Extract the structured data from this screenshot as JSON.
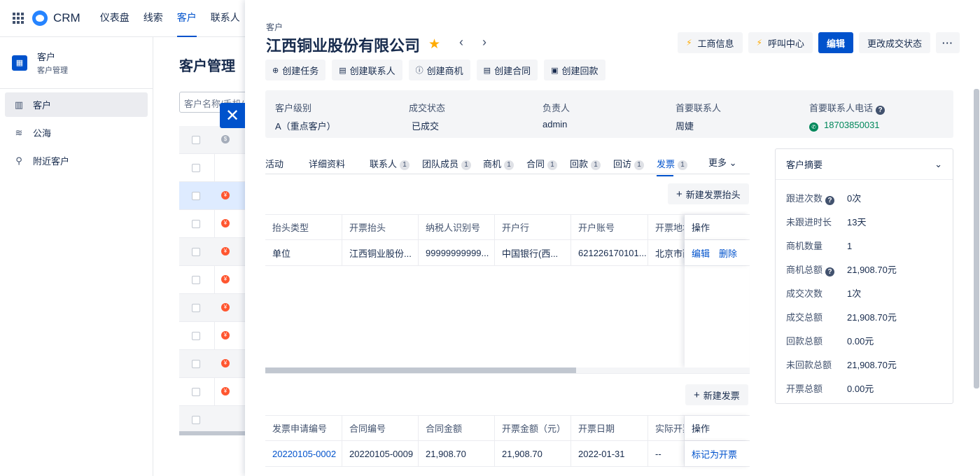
{
  "topnav": {
    "brand": "CRM",
    "items": [
      {
        "label": "仪表盘"
      },
      {
        "label": "线索"
      },
      {
        "label": "客户",
        "active": true
      },
      {
        "label": "联系人"
      }
    ]
  },
  "sidebar": {
    "title": "客户",
    "subtitle": "客户管理",
    "items": [
      {
        "label": "客户",
        "active": true
      },
      {
        "label": "公海"
      },
      {
        "label": "附近客户"
      }
    ]
  },
  "background": {
    "page_title": "客户管理",
    "search_placeholder": "客户名称/手机/"
  },
  "drawer": {
    "breadcrumb": "客户",
    "title": "江西铜业股份有限公司",
    "actions": {
      "business_info": "工商信息",
      "call_center": "呼叫中心",
      "edit": "编辑",
      "change_status": "更改成交状态",
      "more": "···"
    },
    "create_buttons": [
      {
        "label": "创建任务"
      },
      {
        "label": "创建联系人"
      },
      {
        "label": "创建商机"
      },
      {
        "label": "创建合同"
      },
      {
        "label": "创建回款"
      }
    ],
    "info": {
      "level_label": "客户级别",
      "level_value": "A（重点客户）",
      "status_label": "成交状态",
      "status_value": "已成交",
      "owner_label": "负责人",
      "owner_value": "admin",
      "contact_label": "首要联系人",
      "contact_value": "周婕",
      "phone_label": "首要联系人电话",
      "phone_value": "18703850031"
    },
    "tabs": [
      {
        "label": "活动"
      },
      {
        "label": "详细资料"
      },
      {
        "label": "联系人",
        "count": "1"
      },
      {
        "label": "团队成员",
        "count": "1"
      },
      {
        "label": "商机",
        "count": "1"
      },
      {
        "label": "合同",
        "count": "1"
      },
      {
        "label": "回款",
        "count": "1"
      },
      {
        "label": "回访",
        "count": "1"
      },
      {
        "label": "发票",
        "count": "1",
        "active": true
      },
      {
        "label": "更多"
      }
    ],
    "invoice_title": {
      "new_label": "新建发票抬头",
      "headers": [
        "抬头类型",
        "开票抬头",
        "纳税人识别号",
        "开户行",
        "开户账号",
        "开票地址",
        "操作"
      ],
      "rows": [
        {
          "cells": [
            "单位",
            "江西铜业股份...",
            "99999999999...",
            "中国银行(西...",
            "621226170101...",
            "北京市西"
          ],
          "ops": [
            "编辑",
            "删除"
          ]
        }
      ]
    },
    "invoice": {
      "new_label": "新建发票",
      "headers": [
        "发票申请编号",
        "合同编号",
        "合同金额",
        "开票金额（元）",
        "开票日期",
        "实际开票",
        "操作"
      ],
      "rows": [
        {
          "cells": [
            "20220105-0002",
            "20220105-0009",
            "21,908.70",
            "21,908.70",
            "2022-01-31",
            "--"
          ],
          "ops": [
            "标记为开票"
          ]
        }
      ]
    },
    "summary": {
      "title": "客户摘要",
      "rows": [
        {
          "key": "跟进次数",
          "value": "0次",
          "help": true
        },
        {
          "key": "未跟进时长",
          "value": "13天"
        },
        {
          "key": "商机数量",
          "value": "1"
        },
        {
          "key": "商机总额",
          "value": "21,908.70元",
          "help": true
        },
        {
          "key": "成交次数",
          "value": "1次"
        },
        {
          "key": "成交总额",
          "value": "21,908.70元"
        },
        {
          "key": "回款总额",
          "value": "0.00元"
        },
        {
          "key": "未回款总额",
          "value": "21,908.70元"
        },
        {
          "key": "开票总额",
          "value": "0.00元"
        }
      ]
    }
  }
}
